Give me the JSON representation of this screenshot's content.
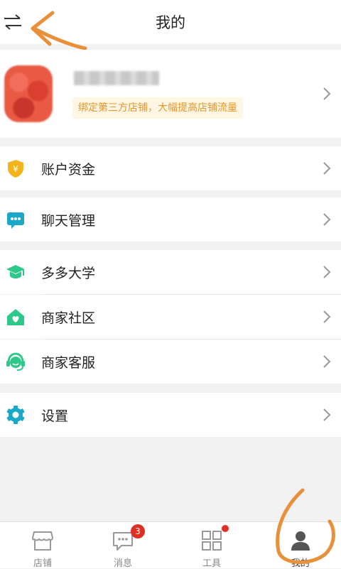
{
  "header": {
    "title": "我的"
  },
  "profile": {
    "promo_text": "绑定第三方店铺，大幅提高店铺流量"
  },
  "menu": [
    {
      "label": "账户资金",
      "icon": "shield-yen-icon"
    },
    {
      "label": "聊天管理",
      "icon": "chat-icon"
    },
    {
      "label": "多多大学",
      "icon": "graduation-cap-icon"
    },
    {
      "label": "商家社区",
      "icon": "house-heart-icon"
    },
    {
      "label": "商家客服",
      "icon": "headset-icon"
    },
    {
      "label": "设置",
      "icon": "gear-icon"
    }
  ],
  "tabbar": {
    "tabs": [
      {
        "label": "店铺",
        "icon": "store-icon"
      },
      {
        "label": "消息",
        "icon": "message-icon",
        "badge": "3"
      },
      {
        "label": "工具",
        "icon": "grid-icon"
      },
      {
        "label": "我的",
        "icon": "person-icon"
      }
    ]
  },
  "colors": {
    "accent_red": "#e02e24",
    "promo_text": "#e8962a",
    "promo_bg": "#fff7e3",
    "green": "#2ec98a",
    "teal": "#1aa7c8",
    "gold": "#f3b41b",
    "annotation": "#e8913a"
  }
}
